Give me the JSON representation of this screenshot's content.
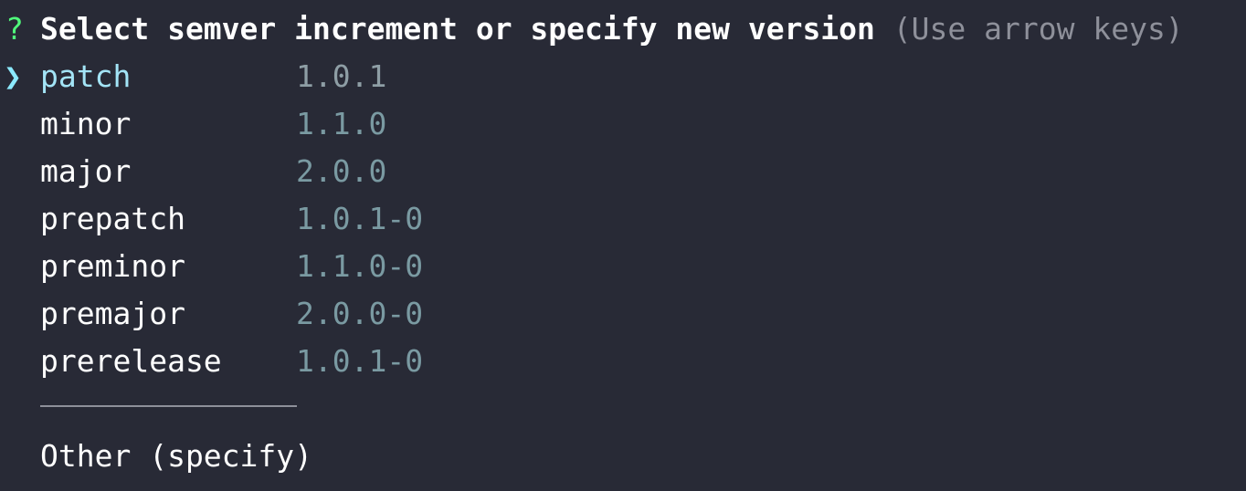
{
  "prompt": {
    "marker": "?",
    "question": "Select semver increment or specify new version",
    "hint": "(Use arrow keys)",
    "pointer": "❯"
  },
  "choices": [
    {
      "name": "patch",
      "version": "1.0.1",
      "selected": true
    },
    {
      "name": "minor",
      "version": "1.1.0",
      "selected": false
    },
    {
      "name": "major",
      "version": "2.0.0",
      "selected": false
    },
    {
      "name": "prepatch",
      "version": "1.0.1-0",
      "selected": false
    },
    {
      "name": "preminor",
      "version": "1.1.0-0",
      "selected": false
    },
    {
      "name": "premajor",
      "version": "2.0.0-0",
      "selected": false
    },
    {
      "name": "prerelease",
      "version": "1.0.1-0",
      "selected": false
    }
  ],
  "other": {
    "label": "Other (specify)"
  },
  "colors": {
    "background": "#282a36",
    "question_mark": "#50fa7b",
    "pointer": "#8be9fd",
    "selected_text": "#a3e4f6",
    "hint": "#8e909a",
    "version": "#7a9aa2"
  }
}
